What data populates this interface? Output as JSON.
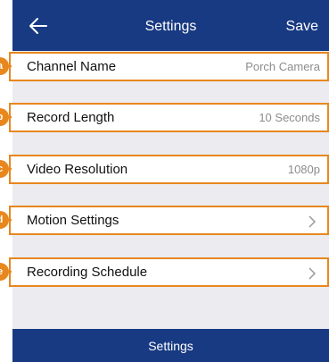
{
  "header": {
    "back_icon": "arrow-left-icon",
    "title": "Settings",
    "save_label": "Save"
  },
  "rows": [
    {
      "label": "Channel Name",
      "value": "Porch Camera"
    },
    {
      "label": "Record Length",
      "value": "10 Seconds"
    },
    {
      "label": "Video Resolution",
      "value": "1080p"
    },
    {
      "label": "Motion Settings",
      "icon": "chevron-right-icon"
    },
    {
      "label": "Recording Schedule",
      "icon": "chevron-right-icon"
    }
  ],
  "footer": {
    "label": "Settings"
  },
  "callouts": [
    "a",
    "b",
    "c",
    "d",
    "e"
  ],
  "colors": {
    "bar": "#183a82",
    "callout": "#e8871e",
    "background": "#ebebf0"
  }
}
